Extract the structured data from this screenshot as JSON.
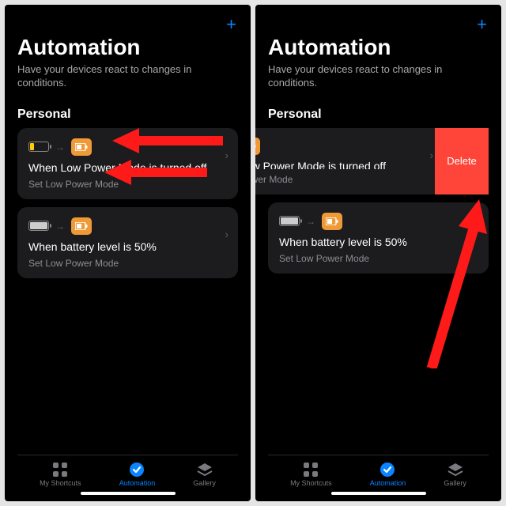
{
  "header": {
    "title": "Automation",
    "subtitle": "Have your devices react to changes in conditions."
  },
  "section": {
    "label": "Personal"
  },
  "cards": [
    {
      "title": "When Low Power Mode is turned off",
      "sub": "Set Low Power Mode"
    },
    {
      "title": "When battery level is 50%",
      "sub": "Set Low Power Mode"
    }
  ],
  "swiped": {
    "title": "Low Power Mode is turned off",
    "sub": "Power Mode",
    "delete": "Delete"
  },
  "tabs": {
    "shortcuts": "My Shortcuts",
    "automation": "Automation",
    "gallery": "Gallery"
  }
}
